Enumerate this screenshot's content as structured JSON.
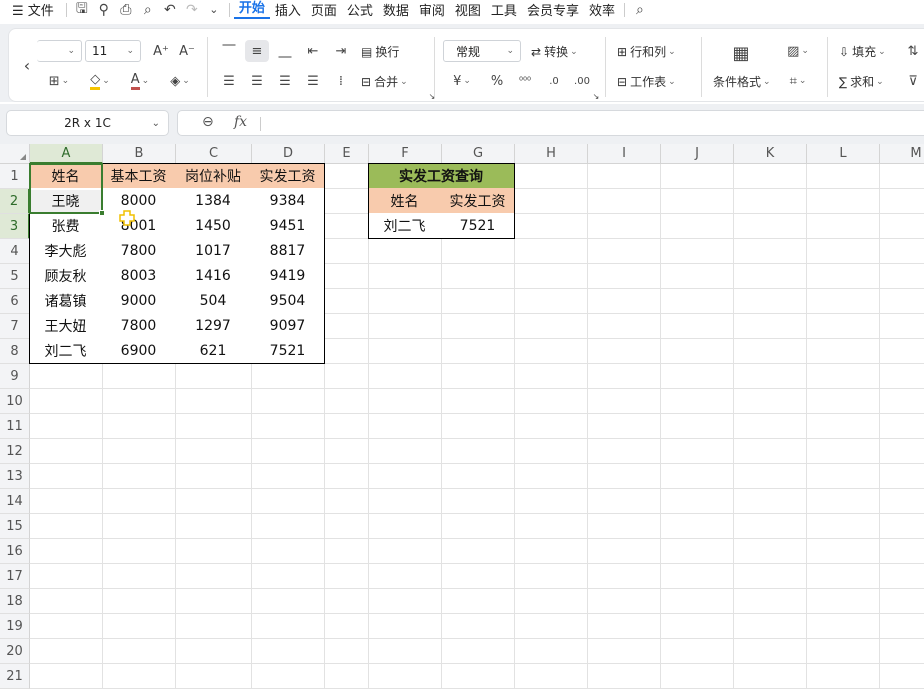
{
  "menu": {
    "file": "文件",
    "tabs": [
      "开始",
      "插入",
      "页面",
      "公式",
      "数据",
      "审阅",
      "视图",
      "工具",
      "会员专享",
      "效率"
    ],
    "active_tab": "开始"
  },
  "ribbon": {
    "font_size": "11",
    "wrap_text": "换行",
    "merge": "合并",
    "number_format": "常规",
    "convert": "转换",
    "rows_cols": "行和列",
    "worksheet": "工作表",
    "conditional_format": "条件格式",
    "fill": "填充",
    "sum": "求和"
  },
  "formula_bar": {
    "name_box": "2R x 1C",
    "fx": "fx",
    "value": ""
  },
  "columns": [
    "A",
    "B",
    "C",
    "D",
    "E",
    "F",
    "G",
    "H",
    "I",
    "J",
    "K",
    "L",
    "M"
  ],
  "rows": [
    "1",
    "2",
    "3",
    "4",
    "5",
    "6",
    "7",
    "8",
    "9",
    "10",
    "11",
    "12",
    "13",
    "14",
    "15",
    "16",
    "17",
    "18",
    "19",
    "20",
    "21"
  ],
  "table": {
    "headers": [
      "姓名",
      "基本工资",
      "岗位补贴",
      "实发工资"
    ],
    "rows": [
      [
        "王晓",
        "8000",
        "1384",
        "9384"
      ],
      [
        "张费",
        "8001",
        "1450",
        "9451"
      ],
      [
        "李大彪",
        "7800",
        "1017",
        "8817"
      ],
      [
        "顾友秋",
        "8003",
        "1416",
        "9419"
      ],
      [
        "诸葛镇",
        "9000",
        "504",
        "9504"
      ],
      [
        "王大妞",
        "7800",
        "1297",
        "9097"
      ],
      [
        "刘二飞",
        "6900",
        "621",
        "7521"
      ]
    ]
  },
  "lookup": {
    "title": "实发工资查询",
    "headers": [
      "姓名",
      "实发工资"
    ],
    "values": [
      "刘二飞",
      "7521"
    ]
  },
  "colors": {
    "header_fill": "#f8cbad",
    "title_fill": "#9bbb59",
    "selection": "#3a7d2f",
    "accent": "#1a73e8"
  }
}
